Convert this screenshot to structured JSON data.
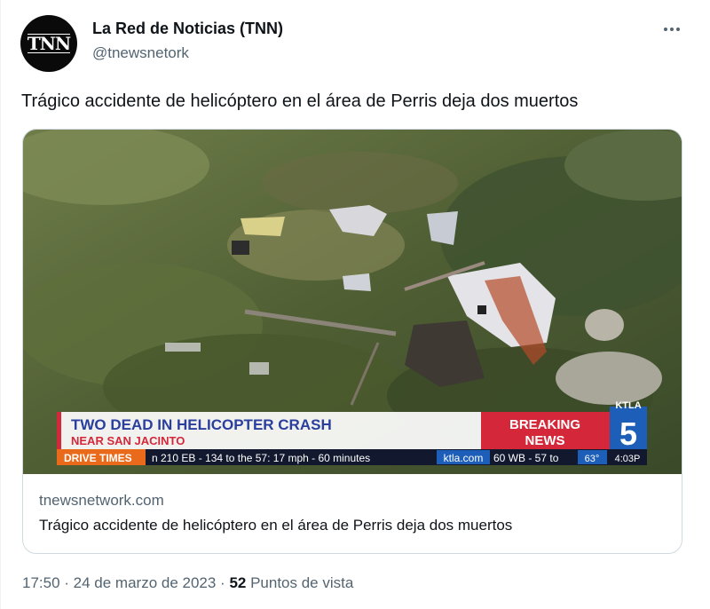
{
  "author": {
    "display_name": "La Red de Noticias (TNN)",
    "handle": "@tnewsnetork",
    "avatar_text": "TNN"
  },
  "more_icon": "more-horizontal-icon",
  "tweet": {
    "text": "Trágico accidente de helicóptero en el área de Perris deja dos muertos"
  },
  "card": {
    "domain": "tnewsnetwork.com",
    "title": "Trágico accidente de helicóptero en el área de Perris deja dos muertos",
    "image": {
      "headline": "TWO DEAD IN HELICOPTER CRASH",
      "subheadline": "NEAR SAN JACINTO",
      "badge_line1": "BREAKING",
      "badge_line2": "NEWS",
      "station": "KTLA",
      "channel": "5",
      "ticker_label": "DRIVE TIMES",
      "ticker_text": "n  210 EB  -  134 to the 57:  17 mph - 60 minutes",
      "ticker_site": "ktla.com",
      "ticker_text2": "60 WB  -  57 to",
      "temperature": "63°",
      "clock": "4:03P"
    }
  },
  "meta": {
    "time": "17:50",
    "separator1": " · ",
    "date": "24 de marzo de 2023",
    "separator2": " · ",
    "views_count": "52",
    "views_label": " Puntos de vista"
  },
  "colors": {
    "text_primary": "#0f1419",
    "text_secondary": "#536471",
    "border": "#cfd9de",
    "news_red": "#d4283a",
    "news_blue": "#2a3e9e",
    "ktla_blue": "#1d5fb8",
    "ticker_orange": "#e86a1a"
  }
}
